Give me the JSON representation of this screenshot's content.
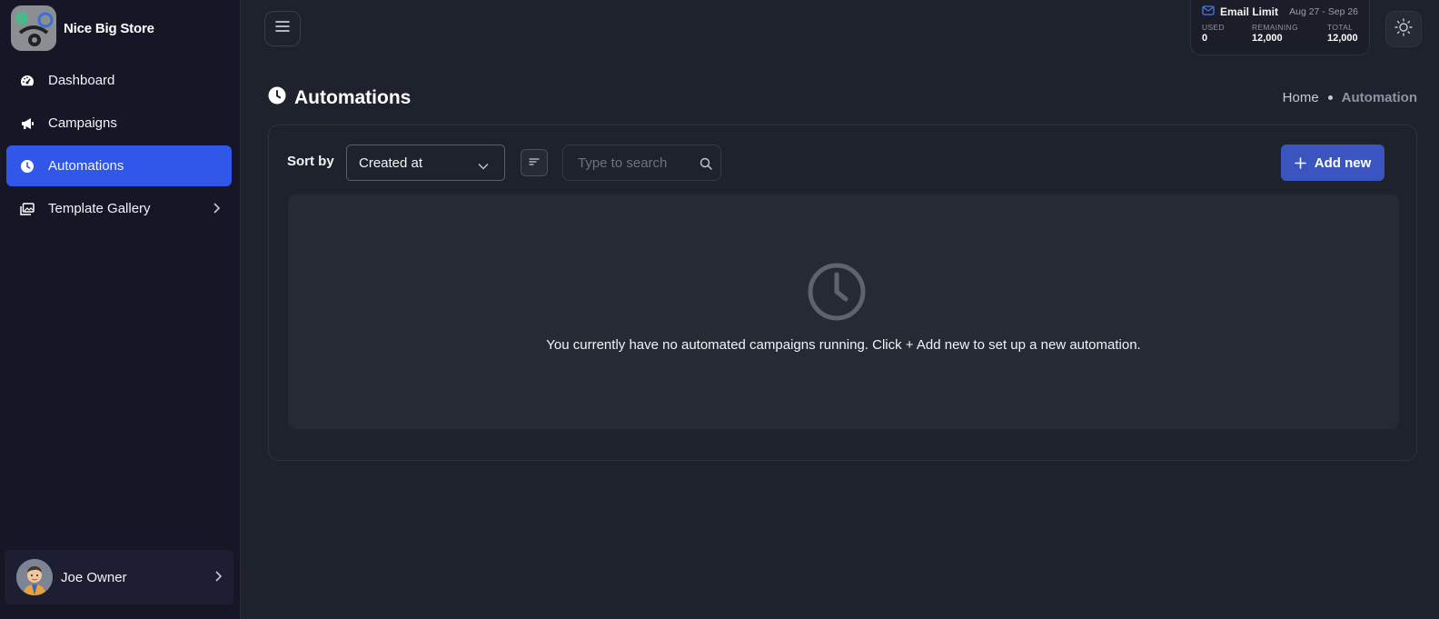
{
  "brand": {
    "name": "Nice Big Store",
    "logo_icon": "store-logo"
  },
  "sidebar": {
    "items": [
      {
        "label": "Dashboard",
        "icon": "gauge-icon"
      },
      {
        "label": "Campaigns",
        "icon": "megaphone-icon"
      },
      {
        "label": "Automations",
        "icon": "clock-icon",
        "active": true
      },
      {
        "label": "Template Gallery",
        "icon": "gallery-icon",
        "has_children": true
      }
    ],
    "user": {
      "name": "Joe Owner"
    }
  },
  "email_limit": {
    "title": "Email Limit",
    "range": "Aug 27 - Sep 26",
    "used_label": "USED",
    "used_value": "0",
    "remaining_label": "REMAINING",
    "remaining_value": "12,000",
    "total_label": "TOTAL",
    "total_value": "12,000"
  },
  "page": {
    "title": "Automations",
    "breadcrumb": {
      "home": "Home",
      "current": "Automation"
    }
  },
  "toolbar": {
    "sort_label": "Sort by",
    "sort_value": "Created at",
    "search_placeholder": "Type to search",
    "add_label": "Add new"
  },
  "empty_state": {
    "message": "You currently have no automated campaigns running. Click + Add new to set up a new automation."
  },
  "colors": {
    "accent": "#3057e8",
    "button": "#3a55bf",
    "background": "#1e222c",
    "sidebar": "#161626"
  }
}
